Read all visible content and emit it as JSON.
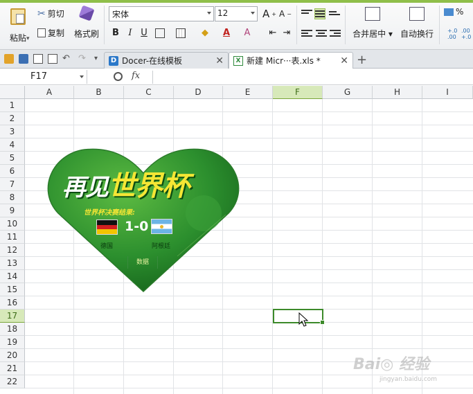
{
  "ribbon": {
    "paste_label": "粘贴",
    "cut_label": "剪切",
    "copy_label": "复制",
    "format_painter_label": "格式刷",
    "font_name": "宋体",
    "font_size": "12",
    "bold": "B",
    "italic": "I",
    "underline": "U",
    "grow_font": "A⁺",
    "shrink_font": "A⁻",
    "merge_center_label": "合并居中",
    "wrap_text_label": "自动换行",
    "percent_label": "%",
    "inc_decimal": "+.0\n.00",
    "dec_decimal": ".00\n+.0",
    "accent_color": "#8fbf4a"
  },
  "tabs": [
    {
      "label": "Docer-在线模板",
      "icon": "docer-icon"
    },
    {
      "label": "新建 Micr···表.xls *",
      "icon": "excel-file-icon"
    }
  ],
  "formula_bar": {
    "name_box": "F17",
    "fx_label": "fx",
    "formula": ""
  },
  "columns": [
    "A",
    "B",
    "C",
    "D",
    "E",
    "F",
    "G",
    "H",
    "I"
  ],
  "rows": [
    "1",
    "2",
    "3",
    "4",
    "5",
    "6",
    "7",
    "8",
    "9",
    "10",
    "11",
    "12",
    "13",
    "14",
    "15",
    "16",
    "17",
    "18",
    "19",
    "20",
    "21",
    "22"
  ],
  "active_cell": {
    "column": "F",
    "row": "17"
  },
  "graphic": {
    "title_part1": "再见",
    "title_part2": "世界杯",
    "subtitle": "世界杯决赛结果:",
    "score": "1-0",
    "team_left": "德国",
    "team_right": "阿根廷",
    "button_label": "数据",
    "green_dark": "#1f7a25",
    "green_light": "#4fae3a"
  },
  "watermark": {
    "text": "Bai 经验",
    "url": "jingyan.baidu.com"
  }
}
